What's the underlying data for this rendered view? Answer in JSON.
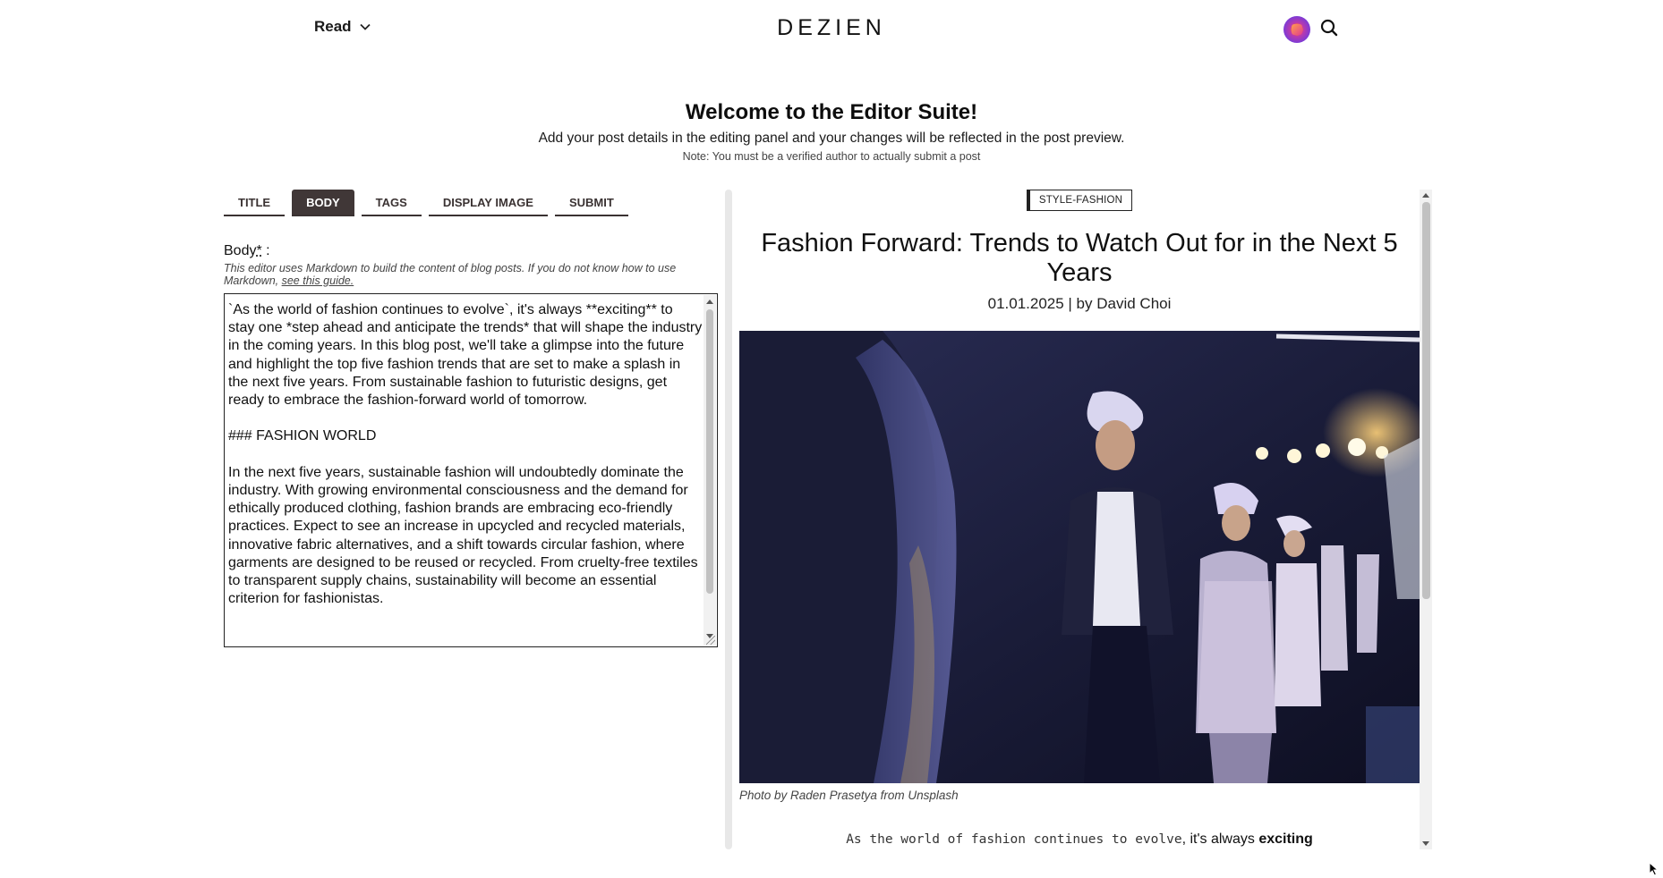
{
  "header": {
    "read_label": "Read",
    "logo": "DEZIEN"
  },
  "intro": {
    "title": "Welcome to the Editor Suite!",
    "subtitle": "Add your post details in the editing panel and your changes will be reflected in the post preview.",
    "note": "Note: You must be a verified author to actually submit a post"
  },
  "tabs": [
    {
      "label": "TITLE",
      "active": false
    },
    {
      "label": "BODY",
      "active": true
    },
    {
      "label": "TAGS",
      "active": false
    },
    {
      "label": "DISPLAY IMAGE",
      "active": false
    },
    {
      "label": "SUBMIT",
      "active": false
    }
  ],
  "editor": {
    "label": "Body",
    "required_mark": "*",
    "label_suffix": " :",
    "help_text": "This editor uses Markdown to build the content of blog posts. If you do not know how to use Markdown, ",
    "help_link": "see this guide.",
    "body_value": "`As the world of fashion continues to evolve`, it's always **exciting** to stay one *step ahead and anticipate the trends* that will shape the industry in the coming years. In this blog post, we'll take a glimpse into the future and highlight the top five fashion trends that are set to make a splash in the next five years. From sustainable fashion to futuristic designs, get ready to embrace the fashion-forward world of tomorrow.\n\n### FASHION WORLD\n\nIn the next five years, sustainable fashion will undoubtedly dominate the industry. With growing environmental consciousness and the demand for ethically produced clothing, fashion brands are embracing eco-friendly practices. Expect to see an increase in upcycled and recycled materials, innovative fabric alternatives, and a shift towards circular fashion, where garments are designed to be reused or recycled. From cruelty-free textiles to transparent supply chains, sustainability will become an essential criterion for fashionistas."
  },
  "preview": {
    "category": "STYLE-FASHION",
    "title": "Fashion Forward: Trends to Watch Out for in the Next 5 Years",
    "meta": "01.01.2025 | by David Choi",
    "caption": "Photo by Raden Prasetya from Unsplash",
    "body_code": "As the world of fashion continues to evolve",
    "body_text": ", it's always ",
    "body_bold": "exciting"
  },
  "colors": {
    "tab_active_bg": "#403737",
    "tab_border": "#3a3232",
    "avatar_accent": "#7c3ad6"
  },
  "icons": [
    "chevron-down-icon",
    "search-icon",
    "avatar",
    "mouse-cursor-icon"
  ]
}
